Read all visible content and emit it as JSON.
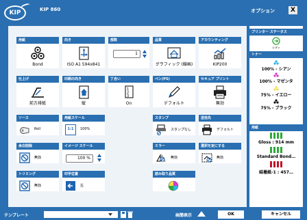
{
  "header": {
    "logo_text": "KIP",
    "model": "KIP 860",
    "options_label": "オプション",
    "close_label": "X"
  },
  "tiles": {
    "paper": {
      "title": "用紙",
      "value": "Bond"
    },
    "orientation": {
      "title": "向き",
      "value": "ISO A1 594x841"
    },
    "copies": {
      "title": "部数",
      "value": "1"
    },
    "quality": {
      "title": "品質",
      "value": "グラフィック (線画)"
    },
    "accounting": {
      "title": "アカウンティング",
      "value": "KIP200"
    },
    "finishing": {
      "title": "仕上げ",
      "value": "前方排紙"
    },
    "print_orientation": {
      "title": "印刷の向き",
      "value": "縦"
    },
    "collate": {
      "title": "丁合い",
      "value": "On"
    },
    "pen": {
      "title": "ペン(PS)",
      "value": "デフォルト"
    },
    "secure_print": {
      "title": "セキュア プリント",
      "value": "無効"
    },
    "source": {
      "title": "ソース",
      "value": "Roll"
    },
    "paper_scale": {
      "title": "用紙スケール",
      "value": "100%",
      "icon_text": "1:1"
    },
    "stamp": {
      "title": "スタンプ",
      "value": "スタンプなし"
    },
    "destination": {
      "title": "送信先",
      "value": "デフォルト"
    },
    "margin_delete": {
      "title": "余白削除",
      "value": "無効"
    },
    "image_scale": {
      "title": "イメージ スケール",
      "value": "100 %"
    },
    "mirror": {
      "title": "ミラー",
      "value": "無効"
    },
    "select_area": {
      "title": "選択を定にする",
      "value": "無効"
    },
    "trimming": {
      "title": "トリミング",
      "value": "無効"
    },
    "print_position": {
      "title": "印字位置",
      "value": "左"
    },
    "scan_quality": {
      "title": "読み取り品質",
      "value": ""
    }
  },
  "sidebar": {
    "printer_status_title": "プリンター ステータス",
    "printer_status": "レディ",
    "toner_title": "トナー",
    "toner": [
      "100% - シアン",
      "100% - マゼンタ",
      "75% - イエロー",
      "75% - ブラック"
    ],
    "paper_title": "用紙",
    "paper": [
      "Gloss : 914 mm",
      "Standard Bond…",
      "結着紙-1 : 457…"
    ]
  },
  "footer": {
    "template_label": "テンプレート",
    "template_value": "",
    "display_label": "画簡表示",
    "ok_label": "OK",
    "cancel_label": "キャンセル"
  },
  "colors": {
    "brand": "#2a6fb1",
    "cyan": "#29b6e8",
    "magenta": "#d63bc6",
    "yellow": "#f1e04a",
    "black": "#111111",
    "green": "#2fa83a",
    "red": "#c0142a"
  }
}
